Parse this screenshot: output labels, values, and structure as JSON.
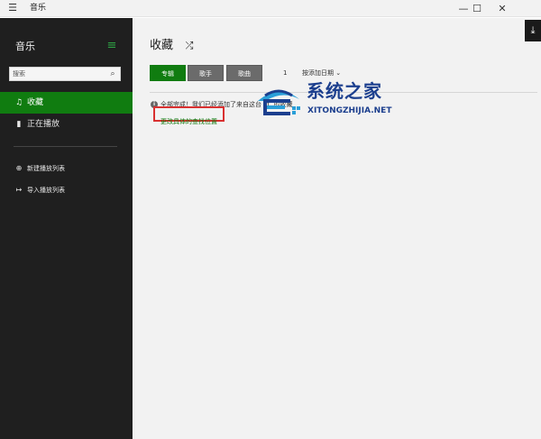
{
  "window": {
    "menu_icon": "hamburger-icon",
    "title": "音乐",
    "controls": {
      "minimize": "—",
      "maximize": "☐",
      "close": "✕"
    }
  },
  "sidebar": {
    "app_name": "音乐",
    "menu_icon": "≡",
    "search": {
      "placeholder": "搜索",
      "icon": "⌕"
    },
    "nav": [
      {
        "label": "收藏",
        "icon": "♫",
        "active": true
      },
      {
        "label": "正在播放",
        "icon": "▮",
        "active": false
      }
    ],
    "actions": [
      {
        "label": "新建播放列表",
        "icon": "⊕"
      },
      {
        "label": "导入播放列表",
        "icon": "↦"
      }
    ]
  },
  "main": {
    "title": "收藏",
    "shuffle_icon": "⤮",
    "tabs": [
      {
        "label": "专辑",
        "active": true
      },
      {
        "label": "歌手",
        "active": false
      },
      {
        "label": "歌曲",
        "active": false
      }
    ],
    "count": "1",
    "sort_label": "按添加日期 ⌄",
    "notice": "全部完成！我们已经添加了来自这台 PC 的收藏",
    "info_icon": "i",
    "change_link": "更改具体的查找位置",
    "download_icon": "⤓"
  },
  "watermark": {
    "cn": "系统之家",
    "en": "XITONGZHIJIA.NET",
    "colors": {
      "primary": "#1c3f8e",
      "accent": "#2a9fd8"
    }
  },
  "colors": {
    "accent_green": "#107c10",
    "sidebar_bg": "#1f1f1f",
    "main_bg": "#f2f2f2",
    "highlight_red": "#d93030"
  }
}
